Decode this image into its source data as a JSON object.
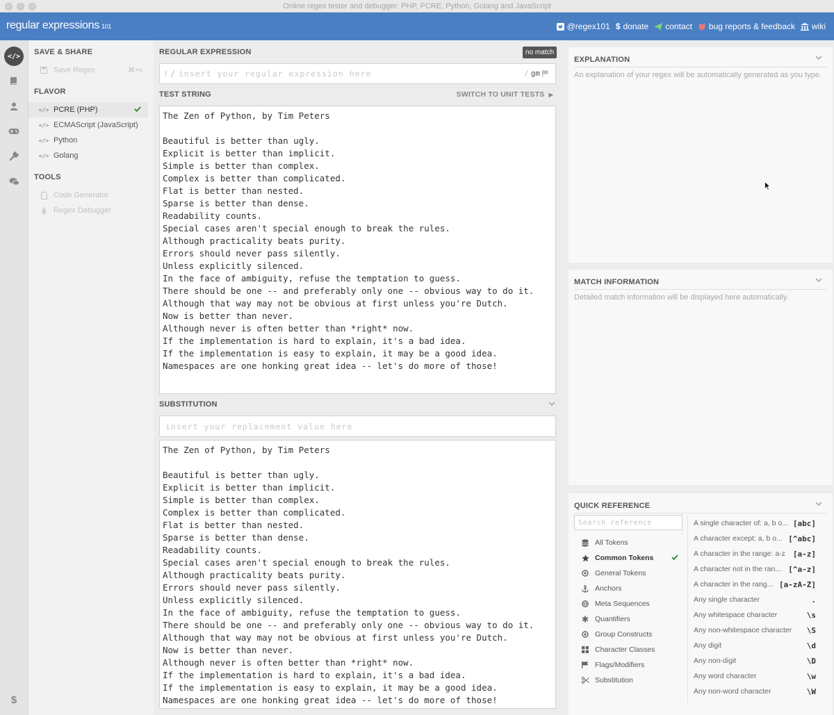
{
  "window": {
    "title": "Online regex tester and debugger: PHP, PCRE, Python, Golang and JavaScript"
  },
  "header": {
    "logo": "regular expressions",
    "logo_version": "101",
    "nav": [
      {
        "icon": "twitter-icon",
        "label": "@regex101"
      },
      {
        "icon": "dollar-icon",
        "label": "donate"
      },
      {
        "icon": "paper-plane-icon",
        "label": "contact"
      },
      {
        "icon": "github-icon",
        "label": "bug reports & feedback"
      },
      {
        "icon": "bank-icon",
        "label": "wiki"
      }
    ]
  },
  "rail": {
    "icons": [
      "code-icon",
      "book-icon",
      "user-icon",
      "gamepad-icon",
      "wrench-icon",
      "chat-icon",
      "dollar-icon"
    ]
  },
  "sidebar": {
    "save_share": {
      "heading": "SAVE & SHARE",
      "save_label": "Save Regex",
      "save_shortcut": "⌘+s"
    },
    "flavor": {
      "heading": "FLAVOR",
      "items": [
        {
          "label": "PCRE (PHP)",
          "selected": true
        },
        {
          "label": "ECMAScript (JavaScript)"
        },
        {
          "label": "Python"
        },
        {
          "label": "Golang"
        }
      ]
    },
    "tools": {
      "heading": "TOOLS",
      "items": [
        {
          "label": "Code Generator"
        },
        {
          "label": "Regex Debugger"
        }
      ]
    }
  },
  "editor": {
    "regex_heading": "REGULAR EXPRESSION",
    "match_status": "no match",
    "regex_placeholder": "insert your regular expression here",
    "regex_value": "",
    "delimiter": "/",
    "flags": "gm",
    "test_heading": "TEST STRING",
    "unit_tests_label": "SWITCH TO UNIT TESTS",
    "substitution_heading": "SUBSTITUTION",
    "substitution_placeholder": "insert your replacement value here",
    "substitution_value": "",
    "test_lines": [
      "The Zen of Python, by Tim Peters",
      "",
      "Beautiful is better than ugly.",
      "Explicit is better than implicit.",
      "Simple is better than complex.",
      "Complex is better than complicated.",
      "Flat is better than nested.",
      "Sparse is better than dense.",
      "Readability counts.",
      "Special cases aren't special enough to break the rules.",
      "Although practicality beats purity.",
      "Errors should never pass silently.",
      "Unless explicitly silenced.",
      "In the face of ambiguity, refuse the temptation to guess.",
      "There should be one -- and preferably only one -- obvious way to do it.",
      "Although that way may not be obvious at first unless you're Dutch.",
      "Now is better than never.",
      "Although never is often better than *right* now.",
      "If the implementation is hard to explain, it's a bad idea.",
      "If the implementation is easy to explain, it may be a good idea.",
      "Namespaces are one honking great idea -- let's do more of those!"
    ]
  },
  "explanation": {
    "heading": "EXPLANATION",
    "text": "An explanation of your regex will be automatically generated as you type."
  },
  "match_info": {
    "heading": "MATCH INFORMATION",
    "text": "Detailed match information will be displayed here automatically."
  },
  "quick_ref": {
    "heading": "QUICK REFERENCE",
    "search_placeholder": "Search reference",
    "categories": [
      {
        "icon": "database-icon",
        "label": "All Tokens"
      },
      {
        "icon": "star-icon",
        "label": "Common Tokens",
        "selected": true
      },
      {
        "icon": "dot-circle-icon",
        "label": "General Tokens"
      },
      {
        "icon": "anchor-icon",
        "label": "Anchors"
      },
      {
        "icon": "globe-icon",
        "label": "Meta Sequences"
      },
      {
        "icon": "asterisk-icon",
        "label": "Quantifiers"
      },
      {
        "icon": "dot-circle-icon",
        "label": "Group Constructs"
      },
      {
        "icon": "grid-icon",
        "label": "Character Classes"
      },
      {
        "icon": "flag-icon",
        "label": "Flags/Modifiers"
      },
      {
        "icon": "scissors-icon",
        "label": "Substitution"
      }
    ],
    "tokens": [
      {
        "desc": "A single character of: a, b or c",
        "display": "A single character of: a, b o...",
        "token": "[abc]"
      },
      {
        "desc": "A character except: a, b or c",
        "display": "A character except: a, b o...",
        "token": "[^abc]"
      },
      {
        "desc": "A character in the range: a-z",
        "display": "A character in the range: a-z",
        "token": "[a-z]"
      },
      {
        "desc": "A character not in the range: a-z",
        "display": "A character not in the ran...",
        "token": "[^a-z]"
      },
      {
        "desc": "A character in the range: a-z or A-Z",
        "display": "A character in the rang...",
        "token": "[a-zA-Z]"
      },
      {
        "desc": "Any single character",
        "display": "Any single character",
        "token": "."
      },
      {
        "desc": "Any whitespace character",
        "display": "Any whitespace character",
        "token": "\\s"
      },
      {
        "desc": "Any non-whitespace character",
        "display": "Any non-whitespace character",
        "token": "\\S"
      },
      {
        "desc": "Any digit",
        "display": "Any digit",
        "token": "\\d"
      },
      {
        "desc": "Any non-digit",
        "display": "Any non-digit",
        "token": "\\D"
      },
      {
        "desc": "Any word character",
        "display": "Any word character",
        "token": "\\w"
      },
      {
        "desc": "Any non-word character",
        "display": "Any non-word character",
        "token": "\\W"
      }
    ]
  },
  "colors": {
    "header": "#4a7fc4",
    "check": "#3b8a3b"
  }
}
